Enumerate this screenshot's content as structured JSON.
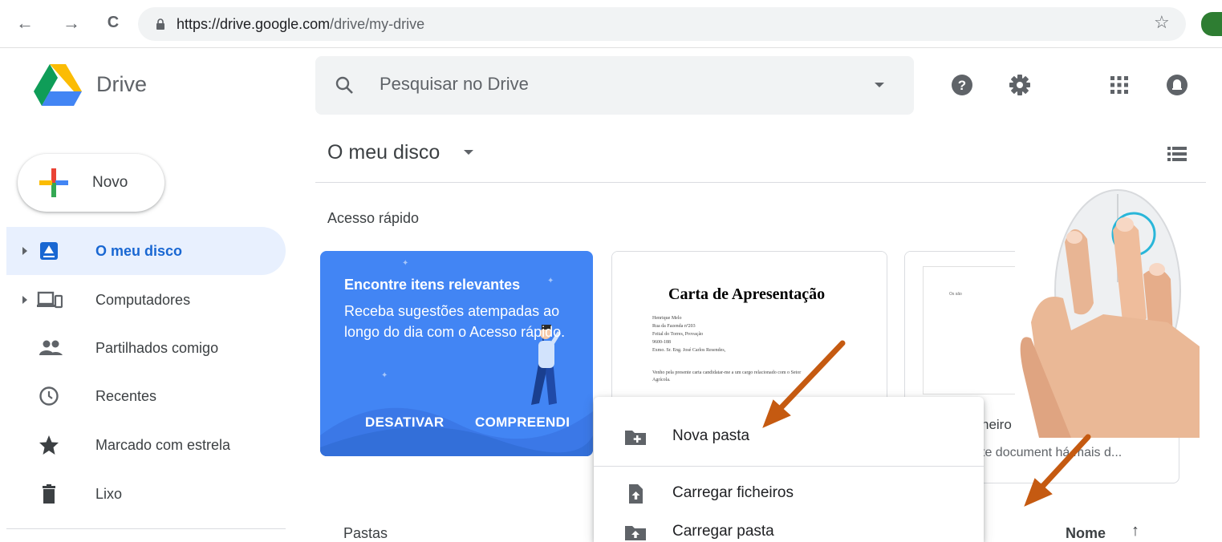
{
  "browser": {
    "back_glyph": "←",
    "forward_glyph": "→",
    "reload_glyph": "C",
    "url_host": "https://drive.google.com",
    "url_path": "/drive/my-drive",
    "bookmark_glyph": "☆"
  },
  "header": {
    "app_name": "Drive",
    "search_placeholder": "Pesquisar no Drive",
    "icons": [
      "help-icon",
      "settings-icon",
      "apps-grid-icon",
      "notifications-icon"
    ]
  },
  "sidebar": {
    "new_button_label": "Novo",
    "items": [
      {
        "label": "O meu disco",
        "icon": "my-drive-icon",
        "active": true,
        "expandable": true
      },
      {
        "label": "Computadores",
        "icon": "computers-icon",
        "active": false,
        "expandable": true
      },
      {
        "label": "Partilhados comigo",
        "icon": "shared-people-icon",
        "active": false,
        "expandable": false
      },
      {
        "label": "Recentes",
        "icon": "clock-icon",
        "active": false,
        "expandable": false
      },
      {
        "label": "Marcado com estrela",
        "icon": "star-icon",
        "active": false,
        "expandable": false
      },
      {
        "label": "Lixo",
        "icon": "trash-icon",
        "active": false,
        "expandable": false
      }
    ]
  },
  "main": {
    "breadcrumb": "O meu disco",
    "quick_access_title": "Acesso rápido",
    "promo": {
      "title": "Encontre itens relevantes",
      "body": "Receba sugestões atempadas ao longo do dia com o Acesso rápido.",
      "dismiss_label": "DESATIVAR",
      "accept_label": "COMPREENDI"
    },
    "doc1": {
      "heading": "Carta de Apresentação",
      "lines": [
        "Henrique Melo",
        "Rua da Fazenda nº203",
        "Feital do Torres, Provação",
        "9600-188",
        "Exmo. Sr. Eng. José Carlos Resendes,",
        "Venho pela presente carta candidatar-me a um cargo relacionado com o Setor",
        "Agrícola."
      ]
    },
    "doc3": {
      "tiny_text": "Os são",
      "name_partial": "neiro",
      "subtitle_partial": "te document  há mais d..."
    },
    "folders_title": "Pastas",
    "sort_label": "Nome",
    "sort_arrow": "↑"
  },
  "context_menu": {
    "items": [
      {
        "label": "Nova pasta",
        "icon": "new-folder-icon"
      },
      {
        "label": "Carregar ficheiros",
        "icon": "upload-file-icon"
      },
      {
        "label": "Carregar pasta",
        "icon": "upload-folder-icon"
      }
    ]
  },
  "colors": {
    "accent_blue": "#1a73e8",
    "active_bg": "#e8f0fe",
    "promo_blue": "#4285f4",
    "annotation_arrow": "#c55a11"
  }
}
